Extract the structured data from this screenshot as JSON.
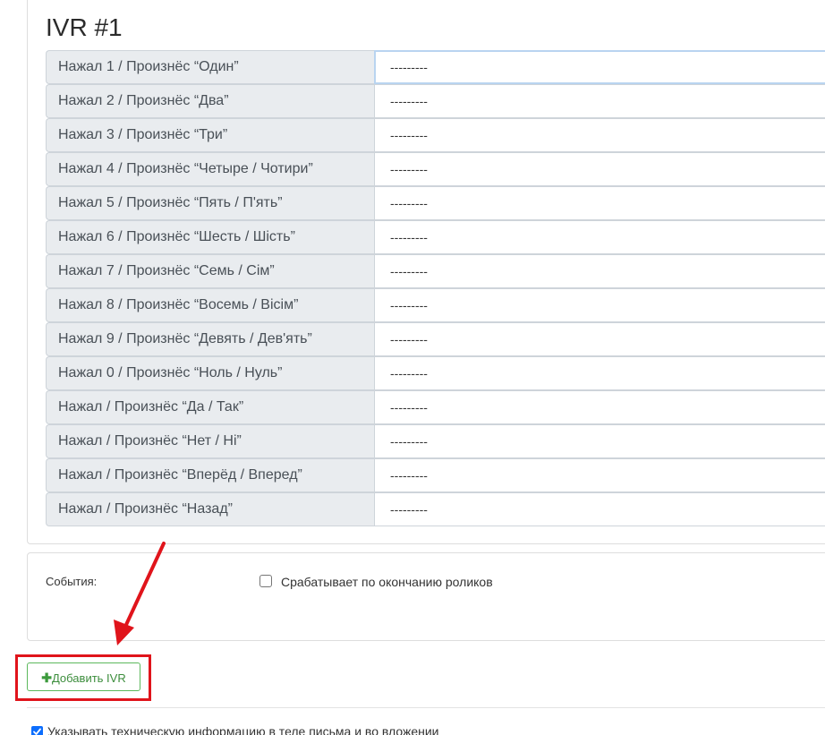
{
  "ivr": {
    "title": "IVR #1",
    "options": [
      {
        "label": "Нажал 1 / Произнёс  “Один”",
        "value": "---------"
      },
      {
        "label": "Нажал 2 / Произнёс  “Два”",
        "value": "---------"
      },
      {
        "label": "Нажал 3 / Произнёс  “Три”",
        "value": "---------"
      },
      {
        "label": "Нажал 4 / Произнёс  “Четыре / Чотири”",
        "value": "---------"
      },
      {
        "label": "Нажал 5 / Произнёс  “Пять / П'ять”",
        "value": "---------"
      },
      {
        "label": "Нажал 6 / Произнёс  “Шесть / Шість”",
        "value": "---------"
      },
      {
        "label": "Нажал 7 / Произнёс  “Семь / Сім”",
        "value": "---------"
      },
      {
        "label": "Нажал 8 / Произнёс  “Восемь / Вісім”",
        "value": "---------"
      },
      {
        "label": "Нажал 9 / Произнёс  “Девять / Дев'ять”",
        "value": "---------"
      },
      {
        "label": "Нажал 0 / Произнёс  “Ноль / Нуль”",
        "value": "---------"
      },
      {
        "label": "Нажал / Произнёс  “Да / Так”",
        "value": "---------"
      },
      {
        "label": "Нажал / Произнёс  “Нет / Ні”",
        "value": "---------"
      },
      {
        "label": "Нажал / Произнёс  “Вперёд / Вперед”",
        "value": "---------"
      },
      {
        "label": "Нажал / Произнёс  “Назад”",
        "value": "---------"
      }
    ]
  },
  "events": {
    "label": "События:",
    "checkbox_label": "Срабатывает по окончанию роликов",
    "checked": false
  },
  "add_button": {
    "icon": "plus-icon",
    "label": "Добавить IVR"
  },
  "tech_info": {
    "label": "Указывать техническую информацию в теле письма и во вложении",
    "checked": true
  },
  "colors": {
    "highlight": "#e0141b",
    "button_accent": "#5cb85c",
    "addon_bg": "#e9ecef"
  }
}
